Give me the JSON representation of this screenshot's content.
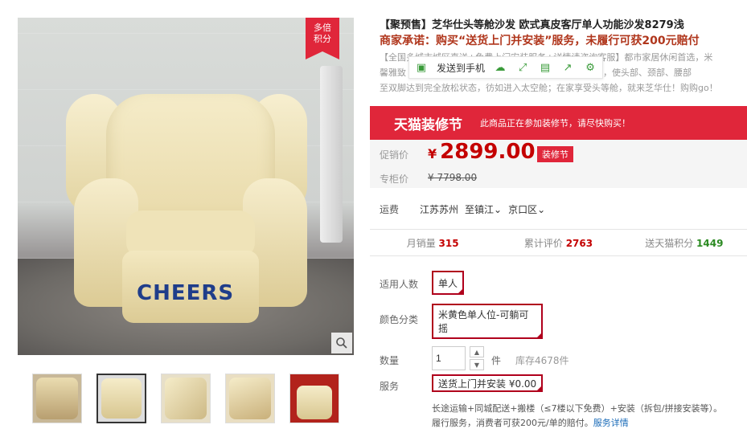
{
  "gallery": {
    "badge": [
      "多倍",
      "积分"
    ],
    "brand": "CHEERS"
  },
  "product": {
    "title": "【聚预售】芝华仕头等舱沙发 欧式真皮客厅单人功能沙发8279浅",
    "promise": "商家承诺：购买“送货上门并安装”服务，未履行可获200元赔付",
    "desc_lines": [
      "【全国多城市城区直送+免费上门安装服务+详情请咨询客服】都市家居休闲首选，米",
      "馨雅致",
      "至双脚达到完全放松状态，彷如进入太空舱；在家享受头等舱，就来芝华仕！购购go！"
    ],
    "desc_right": "体柔然舒适，使头部、颈部、腰部"
  },
  "share_bar": {
    "send_to_phone": "发送到手机"
  },
  "promo": {
    "title": "天猫装修节",
    "note": "此商品正在参加装修节，请尽快购买！"
  },
  "price": {
    "promo_label": "促销价",
    "currency": "¥",
    "current": "2899.00",
    "tag": "装修节",
    "counter_label": "专柜价",
    "counter": "¥ 7798.00"
  },
  "shipping": {
    "label": "运费",
    "from": "江苏苏州",
    "to": "至镇江",
    "district": "京口区"
  },
  "stats": {
    "monthly_label": "月销量",
    "monthly": "315",
    "review_label": "累计评价",
    "reviews": "2763",
    "points_label": "送天猫积分",
    "points": "1449"
  },
  "options": {
    "people_label": "适用人数",
    "people_value": "单人",
    "color_label": "颜色分类",
    "color_value": "米黄色单人位-可躺可摇",
    "qty_label": "数量",
    "qty_value": "1",
    "qty_unit": "件",
    "stock": "库存4678件",
    "service_label": "服务",
    "service_value": "送货上门并安装 ¥0.00",
    "service_note": "长途运输+同城配送+搬楼（≤7楼以下免费）+安装（拆包/拼接安装等）。",
    "service_note2": "履行服务，消费者可获200元/单的赔付。",
    "service_link": "服务详情"
  }
}
